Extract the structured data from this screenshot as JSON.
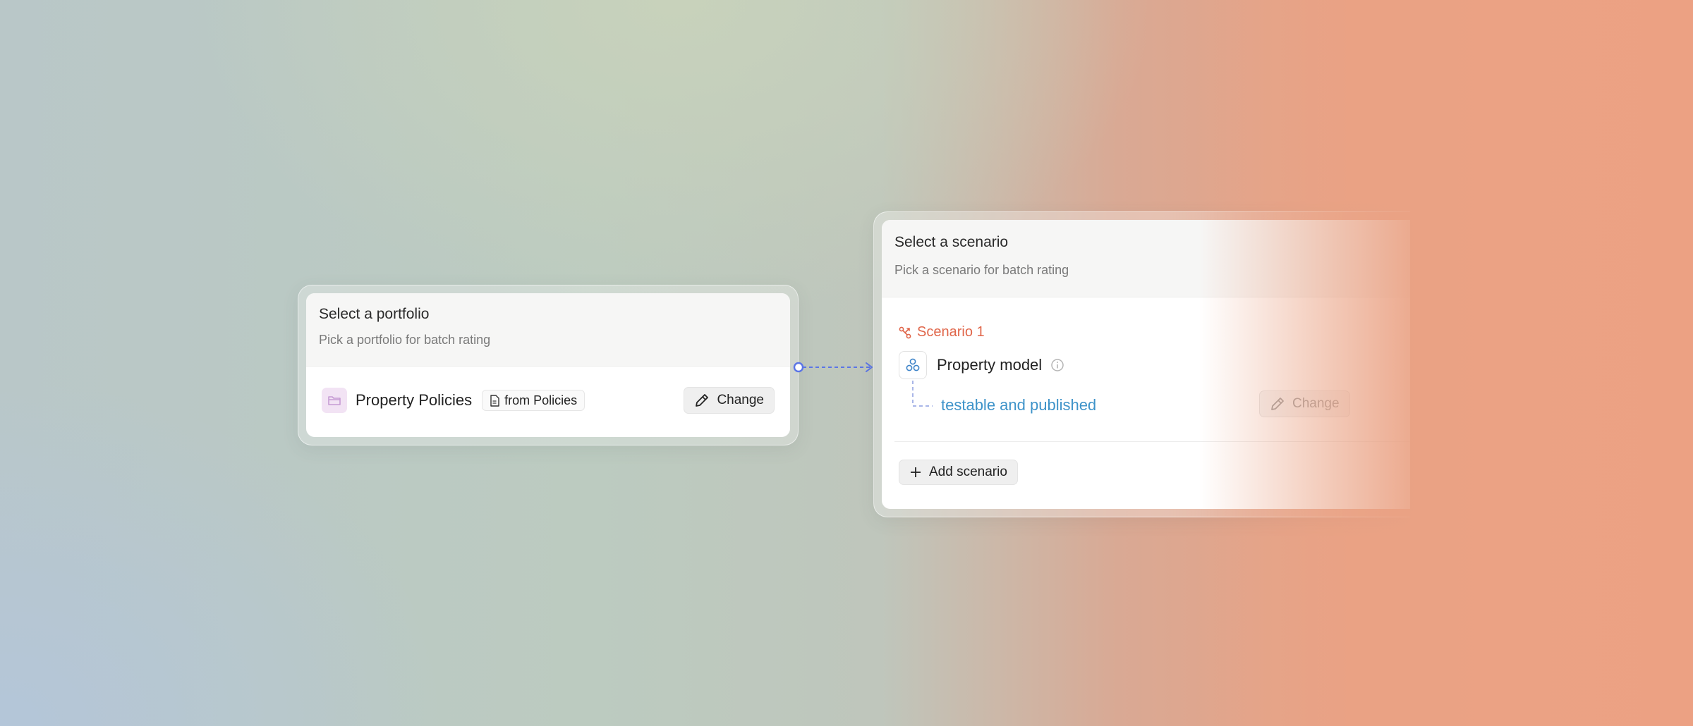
{
  "portfolio": {
    "title": "Select a portfolio",
    "subtitle": "Pick a portfolio for batch rating",
    "name": "Property Policies",
    "source_chip": "from Policies",
    "change_label": "Change"
  },
  "scenario": {
    "title": "Select a scenario",
    "subtitle": "Pick a scenario for batch rating",
    "scenario_label": "Scenario 1",
    "model_name": "Property model",
    "version_label": "testable and published",
    "change_label": "Change",
    "add_label": "Add scenario"
  },
  "colors": {
    "accent_blue": "#5b75e6",
    "scenario_orange": "#e0664a",
    "link_blue": "#3e93c9",
    "folder_purple": "#c69bd3"
  }
}
